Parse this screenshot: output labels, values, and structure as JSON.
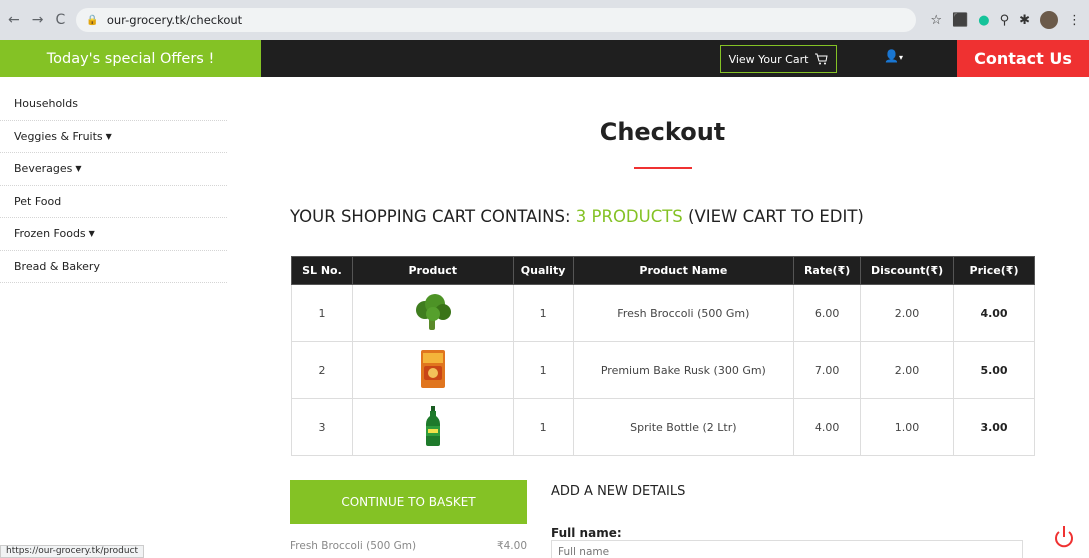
{
  "browser": {
    "url": "our-grocery.tk/checkout",
    "status_url": "https://our-grocery.tk/product"
  },
  "header": {
    "offers": "Today's special Offers !",
    "cart_button": "View Your Cart",
    "contact": "Contact Us"
  },
  "sidebar": {
    "items": [
      {
        "label": "Households",
        "dropdown": false
      },
      {
        "label": "Veggies & Fruits",
        "dropdown": true
      },
      {
        "label": "Beverages",
        "dropdown": true
      },
      {
        "label": "Pet Food",
        "dropdown": false
      },
      {
        "label": "Frozen Foods",
        "dropdown": true
      },
      {
        "label": "Bread & Bakery",
        "dropdown": false
      }
    ]
  },
  "main": {
    "title": "Checkout",
    "summary_prefix": "Your shopping cart contains: ",
    "summary_count": "3 Products",
    "summary_suffix": " (view cart to edit)"
  },
  "table": {
    "headers": [
      "SL No.",
      "Product",
      "Quality",
      "Product Name",
      "Rate(₹)",
      "Discount(₹)",
      "Price(₹)"
    ],
    "rows": [
      {
        "sl": "1",
        "image": "broccoli-icon",
        "qty": "1",
        "name": "Fresh Broccoli (500 Gm)",
        "rate": "6.00",
        "discount": "2.00",
        "price": "4.00"
      },
      {
        "sl": "2",
        "image": "rusk-pack-icon",
        "qty": "1",
        "name": "Premium Bake Rusk (300 Gm)",
        "rate": "7.00",
        "discount": "2.00",
        "price": "5.00"
      },
      {
        "sl": "3",
        "image": "sprite-bottle-icon",
        "qty": "1",
        "name": "Sprite Bottle (2 Ltr)",
        "rate": "4.00",
        "discount": "1.00",
        "price": "3.00"
      }
    ]
  },
  "basket": {
    "continue_label": "Continue to basket",
    "first_item_name": "Fresh Broccoli (500 Gm)",
    "first_item_price": "₹4.00"
  },
  "details": {
    "title": "Add a new Details",
    "full_name_label": "Full name:",
    "full_name_placeholder": "Full name"
  },
  "colors": {
    "accent_green": "#84c225",
    "accent_red": "#ef3131",
    "dark": "#1f1f1f"
  }
}
